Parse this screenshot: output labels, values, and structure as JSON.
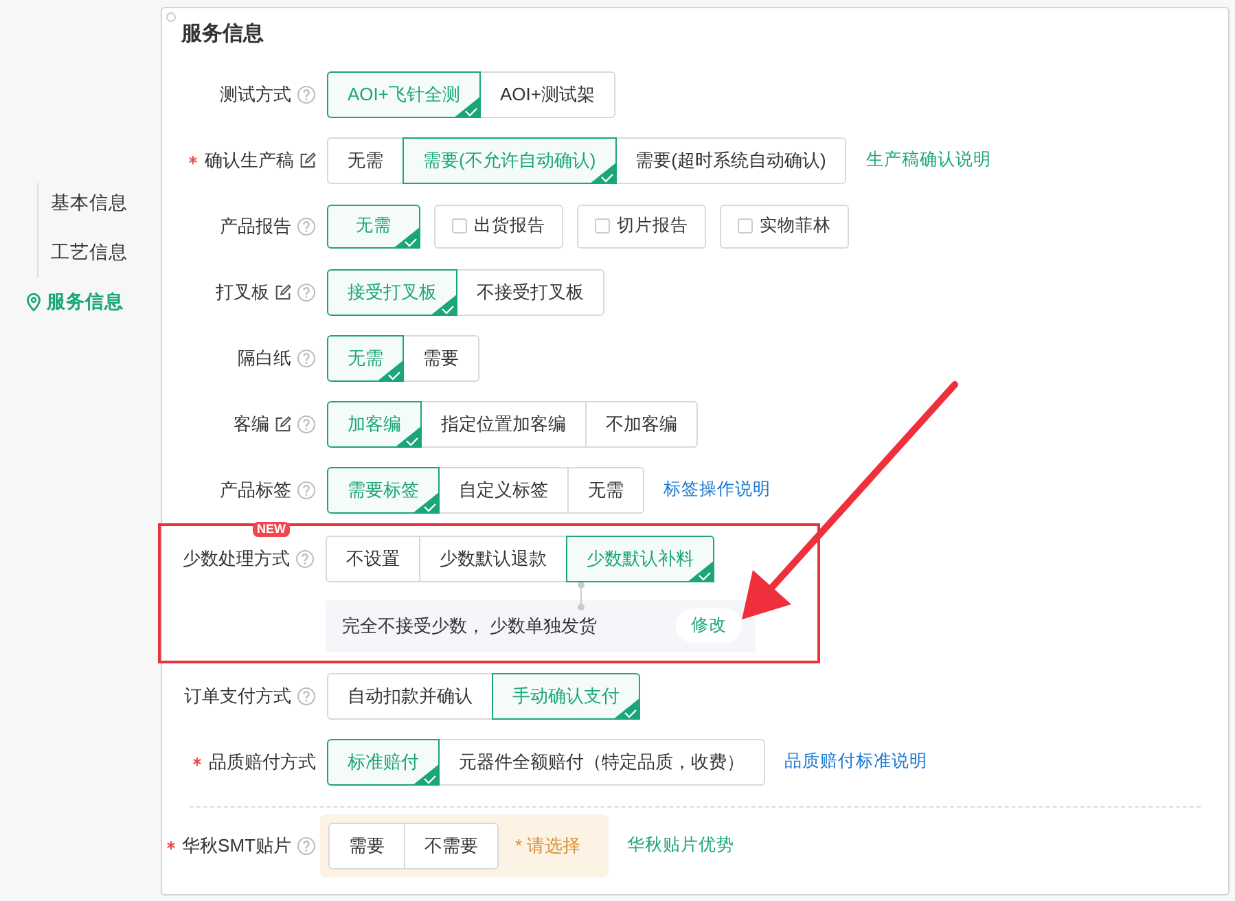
{
  "nav": {
    "items": [
      {
        "label": "基本信息",
        "selected": false
      },
      {
        "label": "工艺信息",
        "selected": false
      },
      {
        "label": "服务信息",
        "selected": true
      }
    ]
  },
  "section": {
    "title": "服务信息",
    "rows": [
      {
        "label": "测试方式",
        "required": false,
        "edit_icon": false,
        "help_icon": true,
        "kind": "segment",
        "options": [
          {
            "label": "AOI+飞针全测",
            "selected": true
          },
          {
            "label": "AOI+测试架",
            "selected": false
          }
        ]
      },
      {
        "label": "确认生产稿",
        "required": true,
        "edit_icon": true,
        "help_icon": false,
        "kind": "segment",
        "options": [
          {
            "label": "无需",
            "selected": false
          },
          {
            "label": "需要(不允许自动确认)",
            "selected": true
          },
          {
            "label": "需要(超时系统自动确认)",
            "selected": false
          }
        ],
        "link": {
          "text": "生产稿确认说明",
          "color": "#1aa57a"
        }
      },
      {
        "label": "产品报告",
        "required": false,
        "edit_icon": false,
        "help_icon": true,
        "kind": "checkbox",
        "options": [
          {
            "label": "无需",
            "selected": true
          },
          {
            "label": "出货报告",
            "selected": false
          },
          {
            "label": "切片报告",
            "selected": false
          },
          {
            "label": "实物菲林",
            "selected": false
          }
        ]
      },
      {
        "label": "打叉板",
        "required": false,
        "edit_icon": true,
        "help_icon": true,
        "kind": "segment",
        "options": [
          {
            "label": "接受打叉板",
            "selected": true
          },
          {
            "label": "不接受打叉板",
            "selected": false
          }
        ]
      },
      {
        "label": "隔白纸",
        "required": false,
        "edit_icon": false,
        "help_icon": true,
        "kind": "segment",
        "options": [
          {
            "label": "无需",
            "selected": true
          },
          {
            "label": "需要",
            "selected": false
          }
        ]
      },
      {
        "label": "客编",
        "required": false,
        "edit_icon": true,
        "help_icon": true,
        "kind": "segment",
        "options": [
          {
            "label": "加客编",
            "selected": true
          },
          {
            "label": "指定位置加客编",
            "selected": false
          },
          {
            "label": "不加客编",
            "selected": false
          }
        ]
      },
      {
        "label": "产品标签",
        "required": false,
        "edit_icon": false,
        "help_icon": true,
        "kind": "segment",
        "options": [
          {
            "label": "需要标签",
            "selected": true
          },
          {
            "label": "自定义标签",
            "selected": false
          },
          {
            "label": "无需",
            "selected": false
          }
        ],
        "link": {
          "text": "标签操作说明",
          "color": "#1677d2"
        }
      },
      {
        "label": "少数处理方式",
        "required": false,
        "edit_icon": false,
        "help_icon": true,
        "badge": "NEW",
        "highlighted": true,
        "kind": "segment",
        "options": [
          {
            "label": "不设置",
            "selected": false
          },
          {
            "label": "少数默认退款",
            "selected": false
          },
          {
            "label": "少数默认补料",
            "selected": true
          }
        ],
        "note": {
          "text": "完全不接受少数， 少数单独发货",
          "button": "修改"
        }
      },
      {
        "label": "订单支付方式",
        "required": false,
        "edit_icon": false,
        "help_icon": true,
        "kind": "segment",
        "options": [
          {
            "label": "自动扣款并确认",
            "selected": false
          },
          {
            "label": "手动确认支付",
            "selected": true
          }
        ]
      },
      {
        "label": "品质赔付方式",
        "required": true,
        "edit_icon": false,
        "help_icon": false,
        "kind": "segment",
        "options": [
          {
            "label": "标准赔付",
            "selected": true
          },
          {
            "label": "元器件全额赔付（特定品质，收费）",
            "selected": false
          }
        ],
        "link": {
          "text": "品质赔付标准说明",
          "color": "#1677d2"
        }
      },
      {
        "label": "华秋SMT贴片",
        "required": true,
        "edit_icon": false,
        "help_icon": true,
        "divider_before": true,
        "kind": "segment",
        "warn": true,
        "options": [
          {
            "label": "需要",
            "selected": false
          },
          {
            "label": "不需要",
            "selected": false
          }
        ],
        "hint": "* 请选择",
        "link": {
          "text": "华秋贴片优势",
          "color": "#1aa57a"
        }
      }
    ]
  },
  "annotation_arrow": true
}
